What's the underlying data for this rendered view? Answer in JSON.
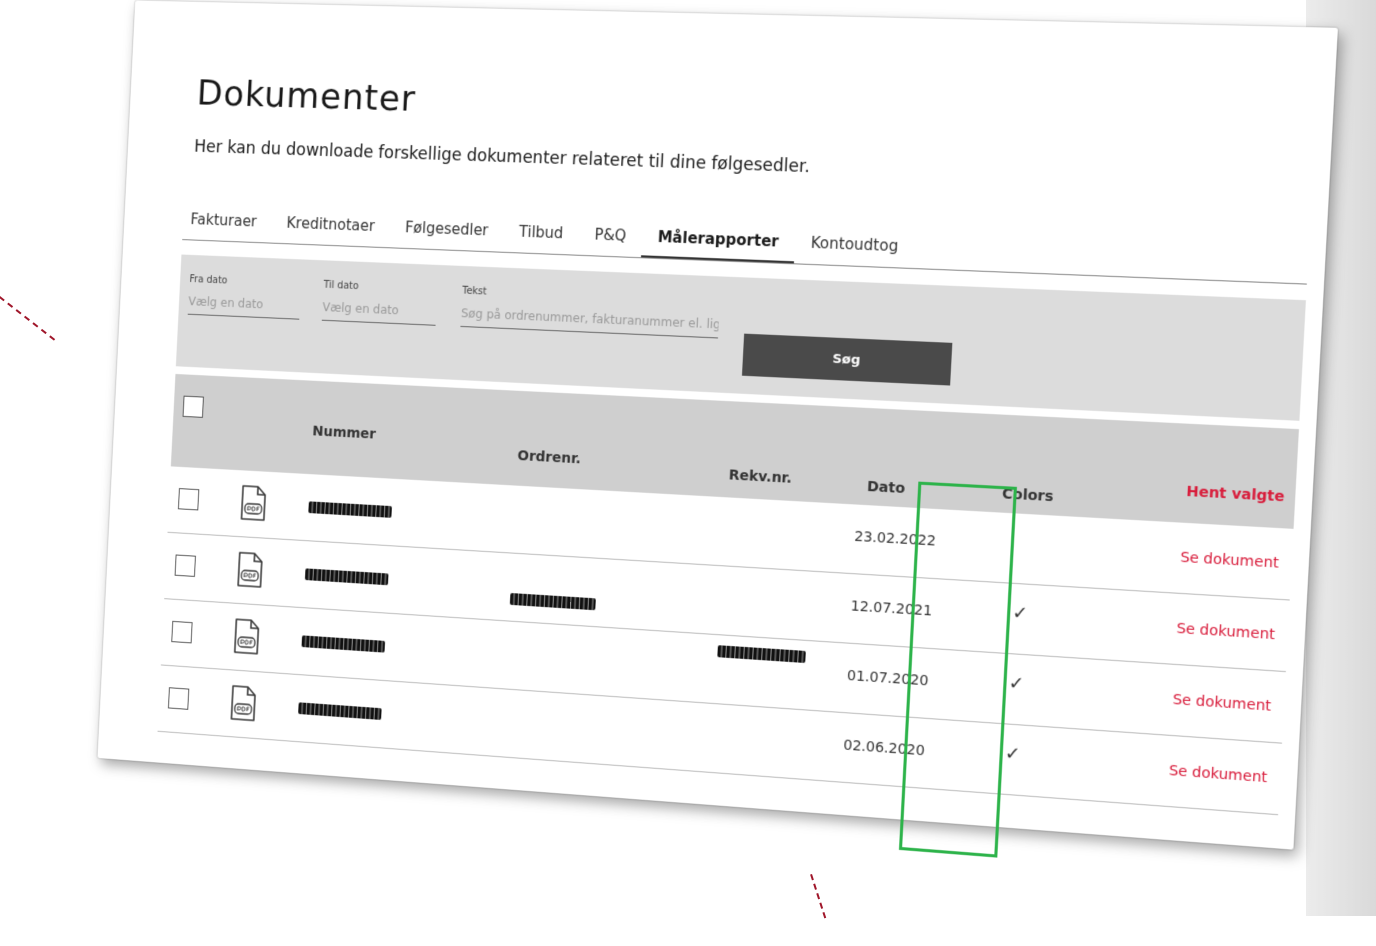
{
  "page": {
    "title": "Dokumenter",
    "subtitle": "Her kan du downloade forskellige dokumenter relateret til dine følgesedler."
  },
  "tabs": [
    {
      "label": "Fakturaer",
      "active": false
    },
    {
      "label": "Kreditnotaer",
      "active": false
    },
    {
      "label": "Følgesedler",
      "active": false
    },
    {
      "label": "Tilbud",
      "active": false
    },
    {
      "label": "P&Q",
      "active": false
    },
    {
      "label": "Målerapporter",
      "active": true
    },
    {
      "label": "Kontoudtog",
      "active": false
    }
  ],
  "filters": {
    "from_date": {
      "label": "Fra dato",
      "placeholder": "Vælg en dato"
    },
    "to_date": {
      "label": "Til dato",
      "placeholder": "Vælg en dato"
    },
    "text": {
      "label": "Tekst",
      "placeholder": "Søg på ordrenummer, fakturanummer el. lign"
    },
    "search_button": "Søg"
  },
  "table": {
    "columns": {
      "nummer": "Nummer",
      "ordrenr": "Ordrenr.",
      "rekvnr": "Rekv.nr.",
      "dato": "Dato",
      "colors": "Colors"
    },
    "bulk_action": "Hent valgte",
    "rows": [
      {
        "dato": "23.02.2022",
        "colors": "",
        "action": "Se dokument"
      },
      {
        "dato": "12.07.2021",
        "colors": "✓",
        "action": "Se dokument"
      },
      {
        "dato": "01.07.2020",
        "colors": "✓",
        "action": "Se dokument"
      },
      {
        "dato": "02.06.2020",
        "colors": "✓",
        "action": "Se dokument"
      }
    ]
  },
  "icons": {
    "file": "pdf-file-icon",
    "check": "check-icon"
  },
  "colors": {
    "accent_red": "#d81b3a",
    "highlight_green": "#2db34a",
    "button_dark": "#4a4a4a",
    "panel_gray": "#dcdcdc"
  }
}
